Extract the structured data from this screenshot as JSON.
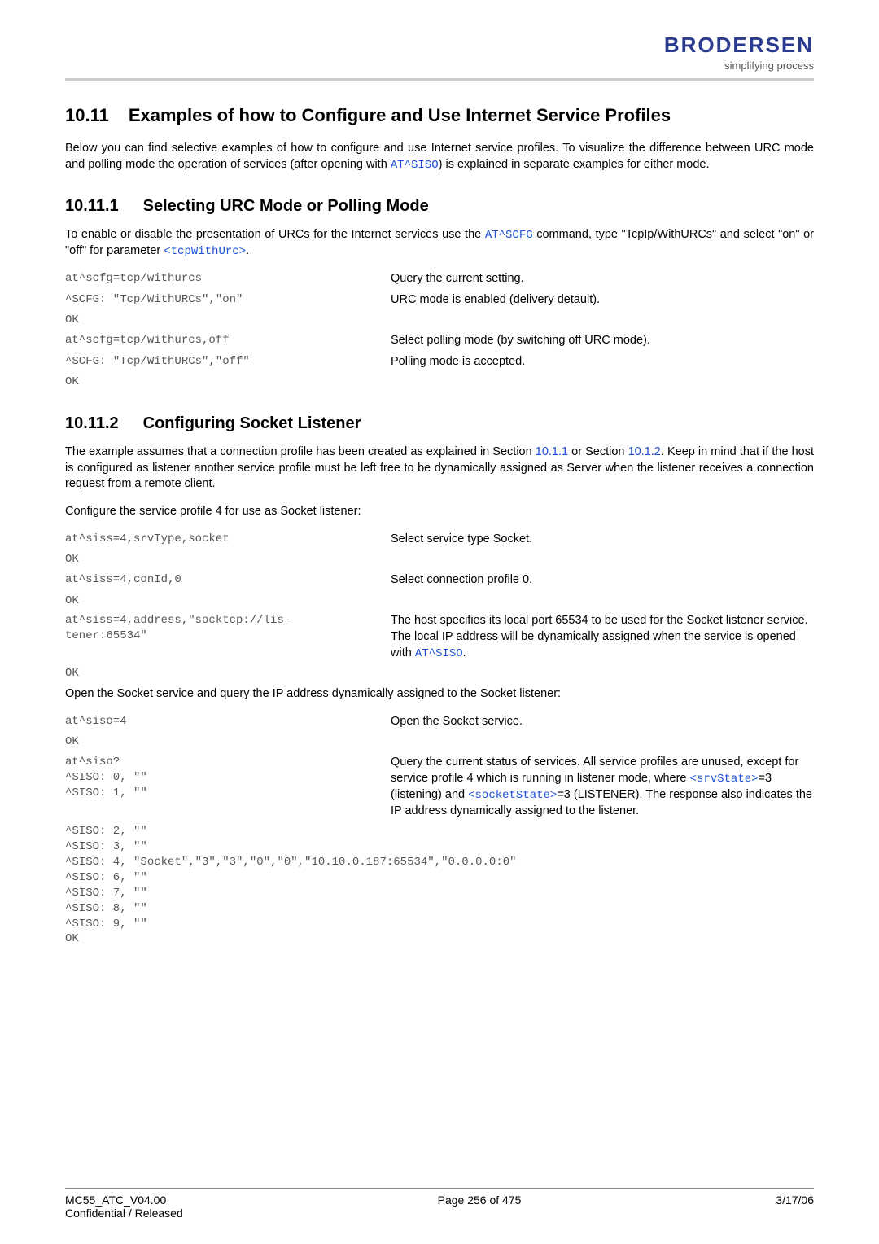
{
  "header": {
    "logo": "BRODERSEN",
    "tagline": "simplifying process"
  },
  "section": {
    "num": "10.11",
    "title": "Examples of how to Configure and Use Internet Service Profiles",
    "intro_a": "Below you can find selective examples of how to configure and use Internet service profiles. To visualize the difference between URC mode and polling mode the operation of services (after opening with ",
    "intro_cmd": "AT^SISO",
    "intro_b": ") is explained in separate examples for either mode."
  },
  "sub1": {
    "num": "10.11.1",
    "title": "Selecting URC Mode or Polling Mode",
    "para_a": "To enable or disable the presentation of URCs for the Internet services use the ",
    "para_cmd": "AT^SCFG",
    "para_b": " command, type \"TcpIp/WithURCs\" and select \"on\" or \"off\" for parameter ",
    "para_param": "<tcpWithUrc>",
    "para_c": ".",
    "row1_left": "at^scfg=tcp/withurcs",
    "row1_right": "Query the current setting.",
    "row2_left": "^SCFG: \"Tcp/WithURCs\",\"on\"",
    "row2_right": "URC mode is enabled (delivery detault).",
    "row3_left": "OK",
    "row4_left": "at^scfg=tcp/withurcs,off",
    "row4_right": "Select polling mode (by switching off URC mode).",
    "row5_left": "^SCFG: \"Tcp/WithURCs\",\"off\"",
    "row5_right": "Polling mode is accepted.",
    "row6_left": "OK"
  },
  "sub2": {
    "num": "10.11.2",
    "title": "Configuring Socket Listener",
    "para1_a": "The example assumes that a connection profile has been created as explained in Section ",
    "para1_link1": "10.1.1",
    "para1_b": " or Section ",
    "para1_link2": "10.1.2",
    "para1_c": ". Keep in mind that if the host is configured as listener another service profile must be left free to be dynamically assigned as Server when the listener receives a connection request from a remote client.",
    "para2": "Configure the service profile 4 for use as Socket listener:",
    "r1_left": "at^siss=4,srvType,socket",
    "r1_right": "Select service type Socket.",
    "r2_left": "OK",
    "r3_left": "at^siss=4,conId,0",
    "r3_right": "Select connection profile 0.",
    "r4_left": "OK",
    "r5_left": "at^siss=4,address,\"socktcp://lis-\ntener:65534\"",
    "r5_right_a": "The host specifies its local port 65534 to be used for the Socket listener service. The local IP address will be dynamically assigned when the service is opened with ",
    "r5_right_cmd": "AT^SISO",
    "r5_right_b": ".",
    "r6_left": "OK",
    "para3": "Open the Socket service and query the IP address dynamically assigned to the Socket listener:",
    "s1_left": "at^siso=4",
    "s1_right": "Open the Socket service.",
    "s2_left": "OK",
    "s3_left": "at^siso?",
    "s3_right_a": "Query the current status of services. All service profiles are unused, except for service profile 4 which is running in listener mode, where ",
    "s3_right_p1": "<srvState>",
    "s3_right_b": "=3 (listening) and ",
    "s3_right_p2": "<socketState>",
    "s3_right_c": "=3 (LISTENER). The response also indicates the IP address dynamically assigned to the listener.",
    "s4_left": "^SISO: 0, \"\"",
    "s5_left": "^SISO: 1, \"\"",
    "tail": "^SISO: 2, \"\"\n^SISO: 3, \"\"\n^SISO: 4, \"Socket\",\"3\",\"3\",\"0\",\"0\",\"10.10.0.187:65534\",\"0.0.0.0:0\"\n^SISO: 6, \"\"\n^SISO: 7, \"\"\n^SISO: 8, \"\"\n^SISO: 9, \"\"\nOK"
  },
  "footer": {
    "left1": "MC55_ATC_V04.00",
    "left2": "Confidential / Released",
    "center": "Page 256 of 475",
    "right": "3/17/06"
  }
}
